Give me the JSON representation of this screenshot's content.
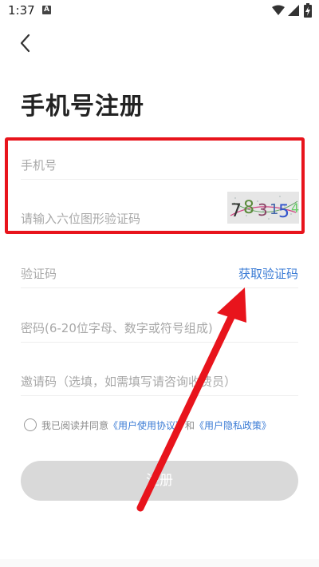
{
  "status_bar": {
    "time": "1:37",
    "notification_letter": "A"
  },
  "header": {
    "title": "手机号注册"
  },
  "form": {
    "phone_placeholder": "手机号",
    "captcha_placeholder": "请输入六位图形验证码",
    "captcha_text": "78315",
    "sms_code_placeholder": "验证码",
    "get_code_label": "获取验证码",
    "password_placeholder": "密码(6-20位字母、数字或符号组成)",
    "invite_placeholder": "邀请码（选填，如需填写请咨询收费员）"
  },
  "agreement": {
    "prefix": "我已阅读并同意",
    "user_agreement": "《用户使用协议》",
    "connector": "和",
    "privacy_policy": "《用户隐私政策》"
  },
  "submit": {
    "label": "注册"
  },
  "colors": {
    "highlight": "#e8141c",
    "link": "#3a7bd5",
    "button_disabled": "#d9d9d9"
  }
}
